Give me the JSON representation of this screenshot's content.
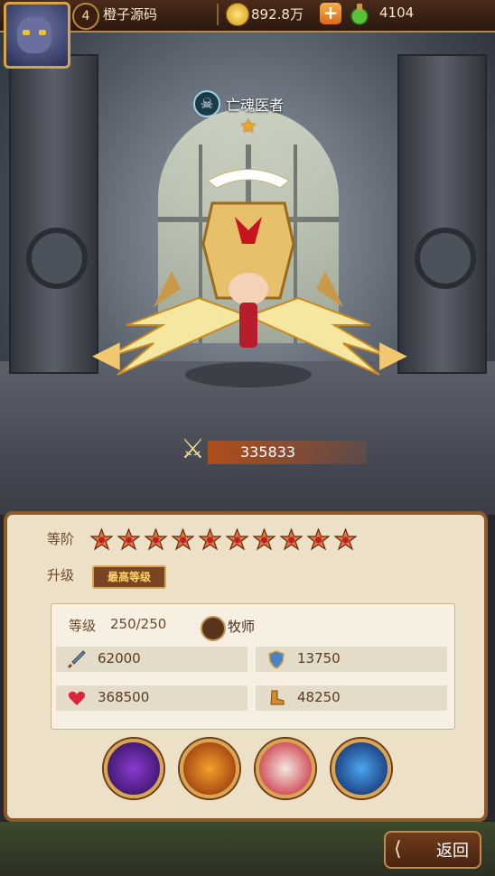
{
  "header": {
    "player_level": "4",
    "player_name": "橙子源码",
    "gold": "892.8万",
    "gems": "4104"
  },
  "hero": {
    "name": "亡魂医者",
    "star_count": 1,
    "power": "335833"
  },
  "panel": {
    "rank_label": "等阶",
    "rank_stars": 10,
    "upgrade_label": "升级",
    "max_level_badge": "最高等级",
    "level_label": "等级",
    "level_value": "250/250",
    "class_name": "牧师",
    "stats": {
      "attack": "62000",
      "defense": "13750",
      "hp": "368500",
      "speed": "48250"
    }
  },
  "back_label": "返回",
  "colors": {
    "accent_gold": "#d9a54f",
    "panel_bg": "#ece0c7",
    "power_bar": "#b54e18"
  }
}
